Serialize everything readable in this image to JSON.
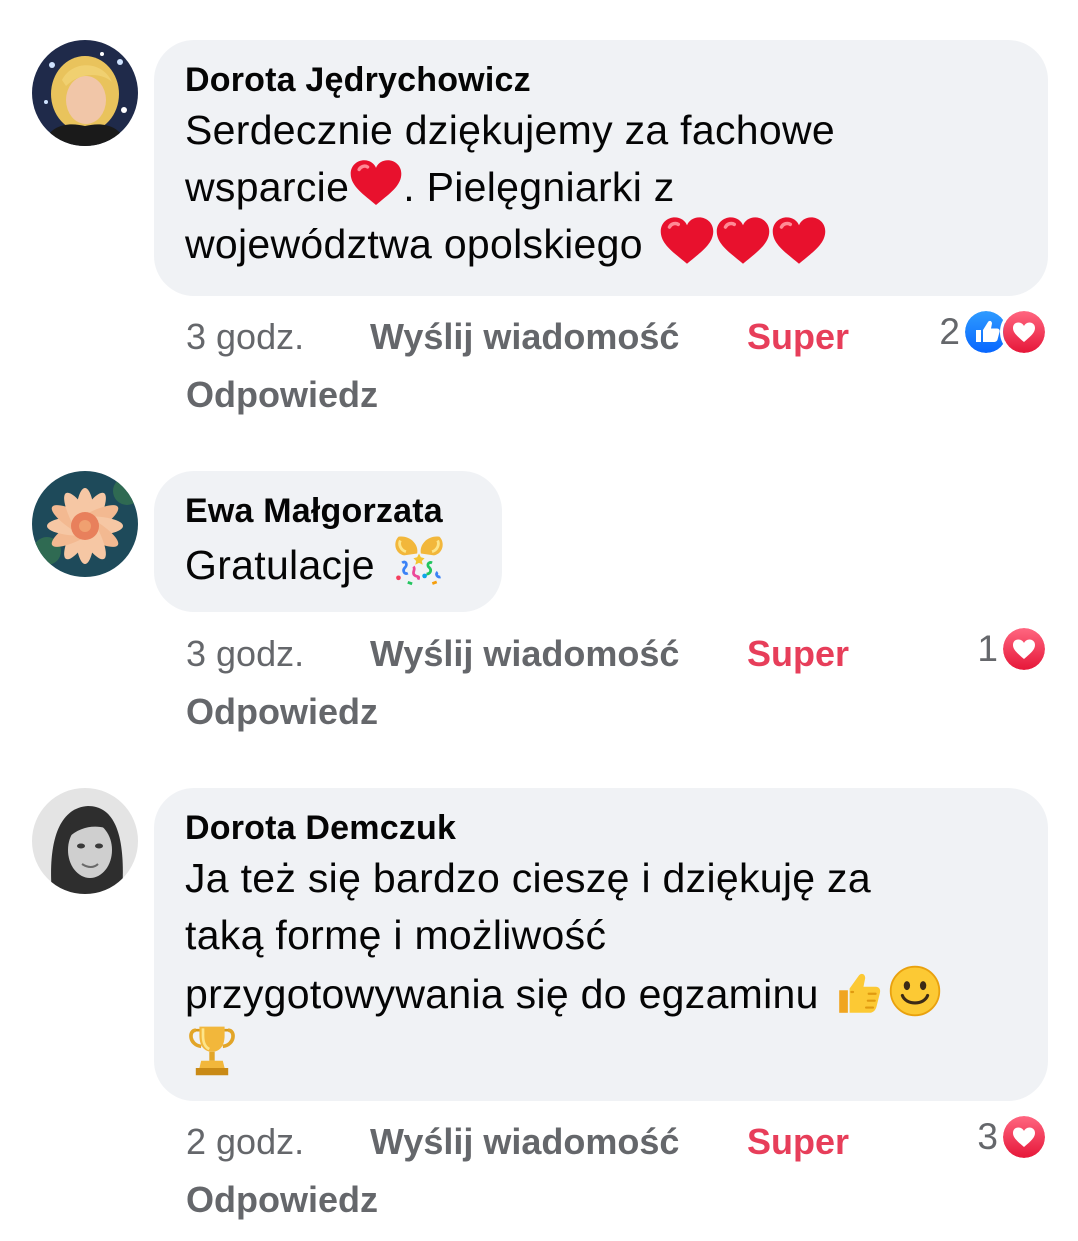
{
  "comments": [
    {
      "author": "Dorota Jędrychowicz",
      "lines": [
        "Serdecznie dziękujemy za fachowe",
        "wsparcie",
        ". Pielęgniarki z",
        "województwa opolskiego"
      ],
      "time": "3 godz.",
      "send_message": "Wyślij wiadomość",
      "reaction_label": "Super",
      "reply": "Odpowiedz",
      "reaction_count": "2",
      "reactions": [
        "like-icon",
        "love-icon"
      ]
    },
    {
      "author": "Ewa Małgorzata",
      "lines": [
        "Gratulacje"
      ],
      "time": "3 godz.",
      "send_message": "Wyślij wiadomość",
      "reaction_label": "Super",
      "reply": "Odpowiedz",
      "reaction_count": "1",
      "reactions": [
        "love-icon"
      ]
    },
    {
      "author": "Dorota Demczuk",
      "lines": [
        "Ja też się  bardzo cieszę i dziękuję za",
        "taką formę i możliwość",
        "przygotowywania się do egzaminu"
      ],
      "time": "2 godz.",
      "send_message": "Wyślij wiadomość",
      "reaction_label": "Super",
      "reply": "Odpowiedz",
      "reaction_count": "3",
      "reactions": [
        "love-icon"
      ]
    }
  ],
  "colors": {
    "bubble": "#f0f2f5",
    "meta_text": "#65676b",
    "super_accent": "#e73e5a",
    "like_blue": "#1877f2",
    "love_red": "#f33e58"
  }
}
